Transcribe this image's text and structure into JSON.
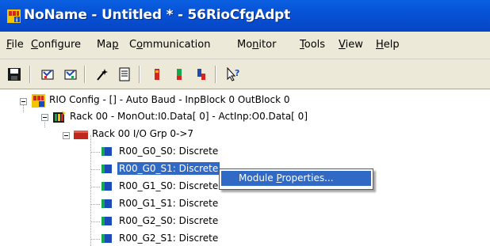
{
  "window": {
    "title": "NoName - Untitled * - 56RioCfgAdpt"
  },
  "menubar": {
    "items": [
      {
        "pre": "",
        "u": "F",
        "post": "ile"
      },
      {
        "pre": "",
        "u": "C",
        "post": "onfigure"
      },
      {
        "pre": "Ma",
        "u": "p",
        "post": ""
      },
      {
        "pre": "C",
        "u": "o",
        "post": "mmunication"
      },
      {
        "pre": "Mo",
        "u": "n",
        "post": "itor"
      },
      {
        "pre": "",
        "u": "T",
        "post": "ools"
      },
      {
        "pre": "",
        "u": "V",
        "post": "iew"
      },
      {
        "pre": "",
        "u": "H",
        "post": "elp"
      }
    ]
  },
  "toolbar": {
    "icons": [
      "save-icon",
      "connect-icon",
      "disconnect-icon",
      "wizard-icon",
      "properties-icon",
      "module-icon",
      "io-icon",
      "rack-icon",
      "help-pointer-icon"
    ]
  },
  "tree": {
    "root": "RIO Config - [] - Auto Baud - InpBlock 0 OutBlock 0",
    "rack": "Rack 00 - MonOut:I0.Data[  0] - ActInp:O0.Data[  0]",
    "group": "Rack 00 I/O Grp 0->7",
    "modules": [
      "R00_G0_S0: Discrete",
      "R00_G0_S1: Discrete",
      "R00_G1_S0: Discrete",
      "R00_G1_S1: Discrete",
      "R00_G2_S0: Discrete",
      "R00_G2_S1: Discrete"
    ],
    "selected_index": 1
  },
  "context_menu": {
    "item_pre": "Module ",
    "item_u": "P",
    "item_post": "roperties..."
  },
  "colors": {
    "titlebar": "#0752d6",
    "selection": "#316ac5",
    "menu_bg": "#ece9d8"
  }
}
